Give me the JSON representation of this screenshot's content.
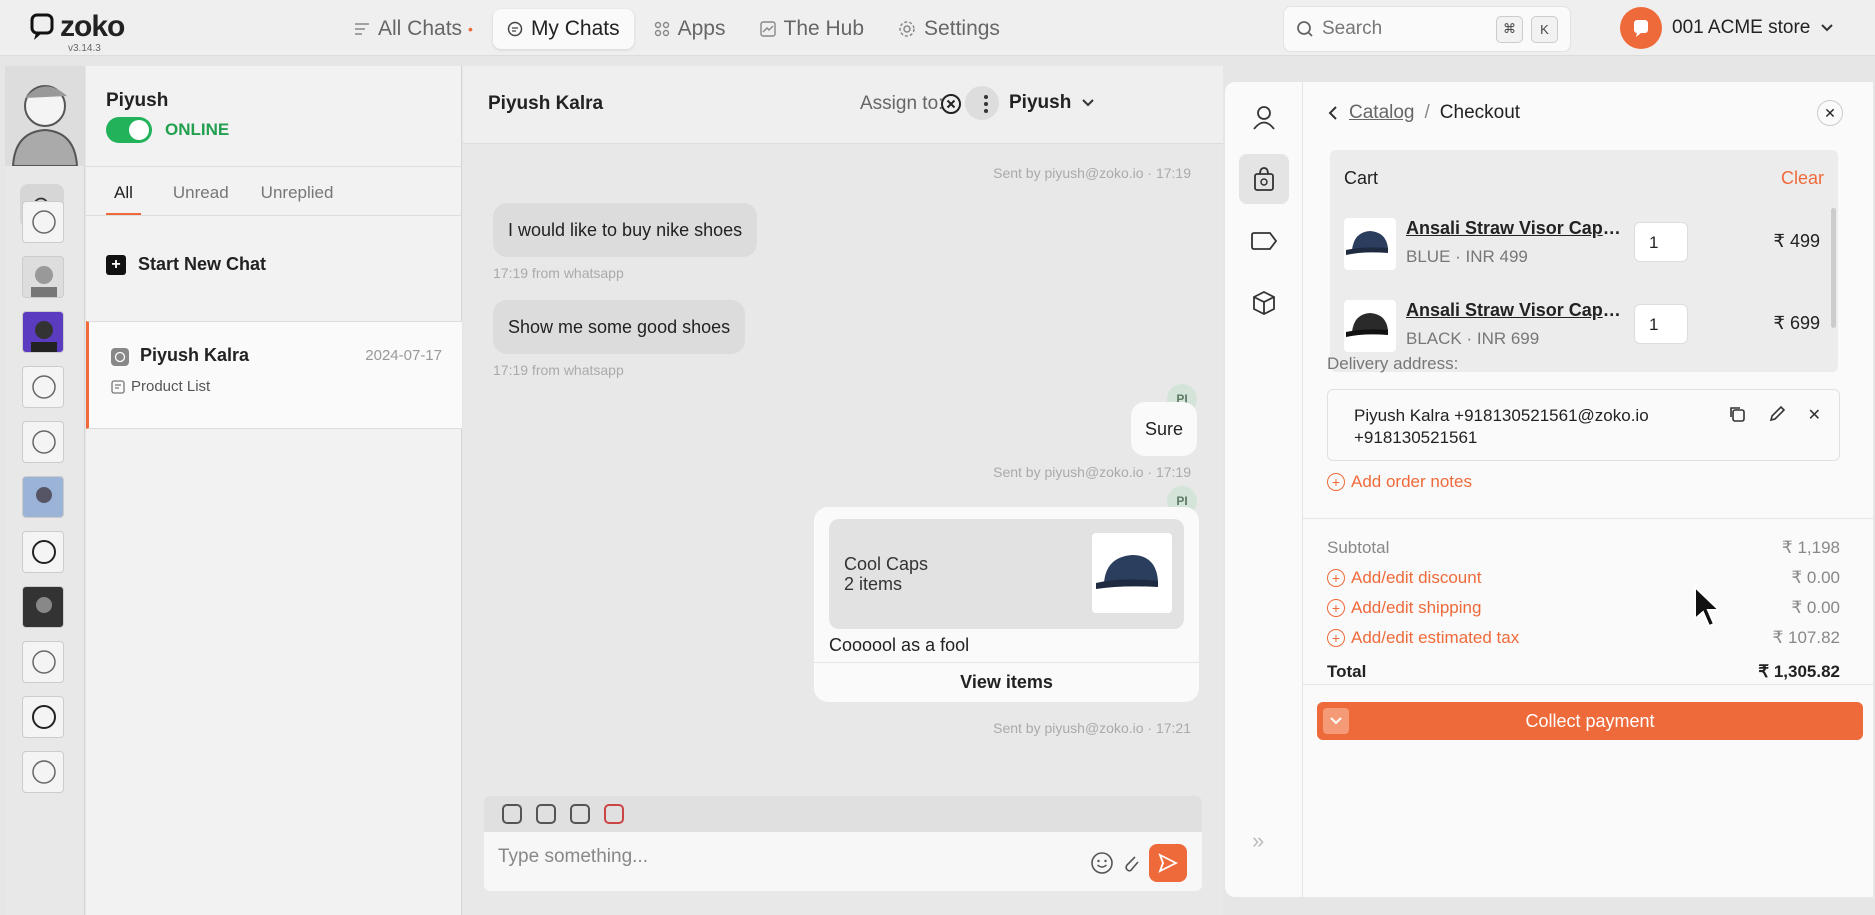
{
  "app": {
    "logo": "zoko",
    "version": "v3.14.3"
  },
  "nav": {
    "items": [
      {
        "label": "All Chats",
        "dot": "•"
      },
      {
        "label": "My Chats"
      },
      {
        "label": "Apps"
      },
      {
        "label": "The Hub"
      },
      {
        "label": "Settings"
      }
    ]
  },
  "search": {
    "placeholder": "Search",
    "kbd1": "⌘",
    "kbd2": "K"
  },
  "store": {
    "name": "001 ACME store"
  },
  "agent": {
    "name": "Piyush",
    "status": "ONLINE"
  },
  "tabs": [
    "All",
    "Unread",
    "Unreplied"
  ],
  "new_chat": "Start New Chat",
  "chat_list": [
    {
      "name": "Piyush Kalra",
      "date": "2024-07-17",
      "sub": "Product List"
    }
  ],
  "chat": {
    "title": "Piyush Kalra",
    "assign_label": "Assign to:",
    "assign_user": "Piyush",
    "messages": {
      "meta1": "Sent by piyush@zoko.io · 17:19",
      "in1": "I would like to buy nike shoes",
      "in1_meta": "17:19 from whatsapp",
      "in2": "Show me some good shoes",
      "in2_meta": "17:19 from whatsapp",
      "avatar_initials": "PI",
      "out1": "Sure",
      "out1_meta": "Sent by piyush@zoko.io · 17:19",
      "card_title": "Cool Caps",
      "card_count": "2 items",
      "card_text": "Coooool as a fool",
      "card_button": "View items",
      "card_meta": "Sent by piyush@zoko.io · 17:21"
    },
    "composer_placeholder": "Type something..."
  },
  "checkout": {
    "crumb_parent": "Catalog",
    "crumb_sep": "/",
    "crumb_current": "Checkout",
    "cart_title": "Cart",
    "clear": "Clear",
    "items": [
      {
        "name": "Ansali Straw Visor Cap (up...",
        "variant": "BLUE · INR 499",
        "qty": "1",
        "price": "₹ 499"
      },
      {
        "name": "Ansali Straw Visor Cap (up...",
        "variant": "BLACK · INR 699",
        "qty": "1",
        "price": "₹ 699"
      }
    ],
    "delivery_label": "Delivery address:",
    "address": "Piyush Kalra +918130521561@zoko.io +918130521561",
    "add_notes": "Add order notes",
    "subtotal_label": "Subtotal",
    "subtotal": "₹ 1,198",
    "discount_label": "Add/edit discount",
    "discount": "₹ 0.00",
    "shipping_label": "Add/edit shipping",
    "shipping": "₹ 0.00",
    "tax_label": "Add/edit estimated tax",
    "tax": "₹ 107.82",
    "total_label": "Total",
    "total": "₹ 1,305.82",
    "collect": "Collect payment"
  },
  "colors": {
    "accent": "#ef6a3a",
    "online": "#22b35a"
  }
}
